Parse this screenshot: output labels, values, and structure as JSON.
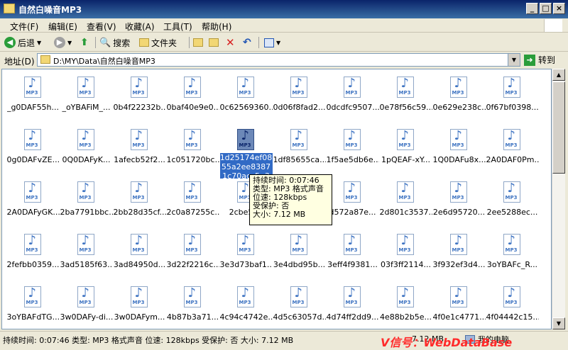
{
  "window": {
    "title": "自然白噪音MP3"
  },
  "menu": {
    "items": [
      "文件(F)",
      "编辑(E)",
      "查看(V)",
      "收藏(A)",
      "工具(T)",
      "帮助(H)"
    ]
  },
  "toolbar": {
    "back_label": "后退",
    "search_label": "搜索",
    "folders_label": "文件夹"
  },
  "address": {
    "label": "地址(D)",
    "path": "D:\\MY\\Data\\自然白噪音MP3",
    "go_label": "转到"
  },
  "files": {
    "icon_tag": "MP3",
    "names": [
      "_g0DAF55h...",
      "_oYBAFiM_...",
      "0b4f22232b...",
      "0baf40e9e0...",
      "0c62569360...",
      "0d06f8fad2...",
      "0dcdfc9507...",
      "0e78f56c59...",
      "0e629e238c...",
      "0f67bf0398...",
      "0g0DAFvZE...",
      "0Q0DAFyK...",
      "1afecb52f2...",
      "1c051720bc...",
      "1d25174ef0855a2ee83871c70acc5e3",
      "1df85655ca...",
      "1f5ae5db6e...",
      "1pQEAF-xY...",
      "1Q0DAFu8x...",
      "2A0DAF0Pm...",
      "2A0DAFyGK...",
      "2ba7791bbc...",
      "2bb28d35cf...",
      "2c0a87255c...",
      "2cbe514",
      "",
      "d572a87e...",
      "2d801c3537...",
      "2e6d95720...",
      "2ee5288ec...",
      "2fefbb0359...",
      "3ad5185f63...",
      "3ad84950d...",
      "3d22f2216c...",
      "3e3d73baf1...",
      "3e4dbd95b...",
      "3eff4f9381...",
      "03f3ff2114...",
      "3f932ef3d4...",
      "3oYBAFc_R...",
      "3oYBAFdTG...",
      "3w0DAFy-di...",
      "3w0DAFym...",
      "4b87b3a71...",
      "4c94c4742e...",
      "4d5c63057d...",
      "4d74ff2dd9...",
      "4e88b2b5e...",
      "4f0e1c4771...",
      "4f04442c15..."
    ],
    "selected_index": 14
  },
  "tooltip": {
    "lines": [
      "持续时间: 0:07:46",
      "类型: MP3 格式声音",
      "位速: 128kbps",
      "受保护: 否",
      "大小: 7.12 MB"
    ]
  },
  "status": {
    "main": "持续时间: 0:07:46 类型: MP3 格式声音 位速: 128kbps 受保护: 否 大小: 7.12 MB",
    "size": "7.12 MB",
    "zone": "我的电脑"
  },
  "watermark": "V信号：WebDataBase"
}
